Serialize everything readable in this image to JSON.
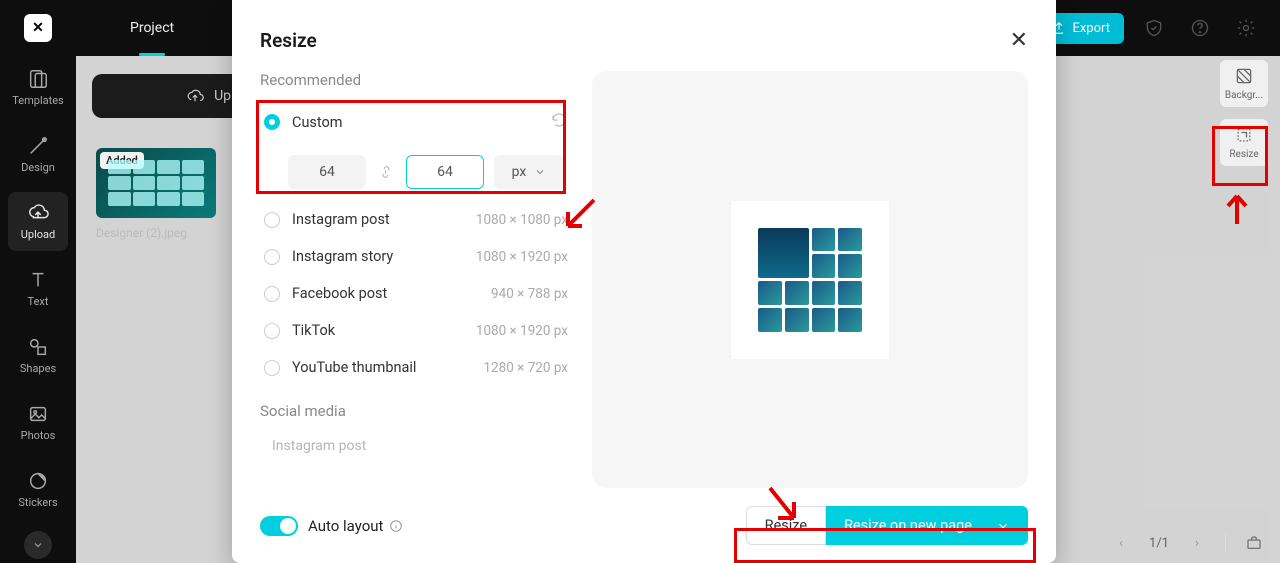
{
  "tabs": {
    "project": "Project"
  },
  "leftRail": {
    "items": [
      {
        "label": "Templates"
      },
      {
        "label": "Design"
      },
      {
        "label": "Upload"
      },
      {
        "label": "Text"
      },
      {
        "label": "Shapes"
      },
      {
        "label": "Photos"
      },
      {
        "label": "Stickers"
      }
    ]
  },
  "uploadPanel": {
    "button": "Upload",
    "badge": "Added",
    "thumbLabel": "Designer (2).jpeg"
  },
  "topActions": {
    "export": "Export"
  },
  "rightPanel": {
    "background": "Backgr...",
    "resize": "Resize"
  },
  "modal": {
    "title": "Resize",
    "sections": {
      "recommended": "Recommended",
      "socialMedia": "Social media"
    },
    "custom": {
      "label": "Custom",
      "width": "64",
      "height": "64",
      "unit": "px"
    },
    "options": [
      {
        "name": "Instagram post",
        "dim": "1080 × 1080 px"
      },
      {
        "name": "Instagram story",
        "dim": "1080 × 1920 px"
      },
      {
        "name": "Facebook post",
        "dim": "940 × 788 px"
      },
      {
        "name": "TikTok",
        "dim": "1080 × 1920 px"
      },
      {
        "name": "YouTube thumbnail",
        "dim": "1280 × 720 px"
      }
    ],
    "socialSub": "Instagram post",
    "autoLayout": "Auto layout",
    "resizeBtn": "Resize",
    "resizeNewPage": "Resize on new page"
  },
  "pager": {
    "pos": "1/1"
  }
}
